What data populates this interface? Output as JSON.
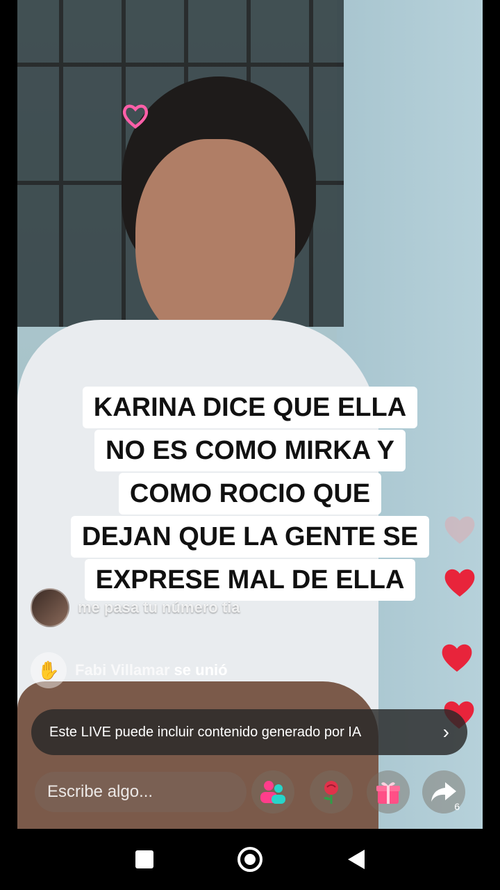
{
  "caption": {
    "lines": [
      "KARINA DICE QUE ELLA",
      "NO ES COMO MIRKA Y",
      "COMO ROCIO QUE",
      "DEJAN QUE LA GENTE SE",
      "EXPRESE MAL DE ELLA"
    ]
  },
  "comments": {
    "message": "me pasa tu número tia",
    "join_name": "Fabi Villamar",
    "join_suffix": "se unió"
  },
  "ai_notice": {
    "text": "Este LIVE puede incluir contenido generado por IA"
  },
  "composer": {
    "placeholder": "Escribe algo..."
  },
  "actions": {
    "share_count": "6"
  },
  "icons": {
    "multi_guest": "multi-guest-icon",
    "rose": "rose-gift-icon",
    "gift": "gift-box-icon",
    "share": "share-arrow-icon",
    "hearts": "heart-icon"
  },
  "colors": {
    "heart": "#e8243b",
    "heart_faded": "#e7a3a8",
    "banner_bg": "#2a2a2a",
    "caption_bg": "#ffffff"
  }
}
